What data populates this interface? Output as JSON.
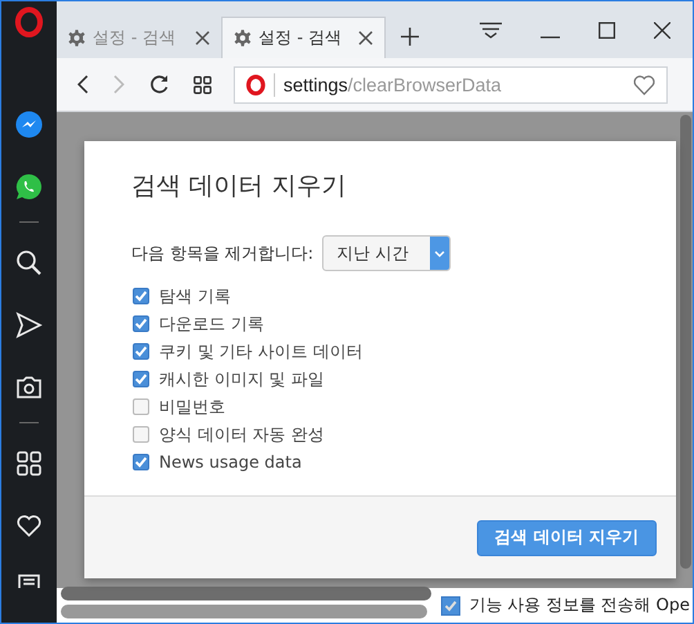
{
  "browser": {
    "tabs": [
      {
        "title": "설정 - 검색",
        "selected": false
      },
      {
        "title": "설정 - 검색",
        "selected": true
      }
    ],
    "address": {
      "host": "settings",
      "path": "/clearBrowserData"
    }
  },
  "sidebar": {
    "items": [
      {
        "kind": "messenger"
      },
      {
        "kind": "whatsapp"
      },
      {
        "kind": "divider"
      },
      {
        "kind": "search"
      },
      {
        "kind": "send"
      },
      {
        "kind": "camera"
      },
      {
        "kind": "divider"
      },
      {
        "kind": "grid"
      },
      {
        "kind": "heart"
      },
      {
        "kind": "news"
      }
    ]
  },
  "background_page": {
    "option": {
      "label": "기능 사용 정보를 전송해 Ope",
      "checked": true
    }
  },
  "dialog": {
    "title": "검색 데이터 지우기",
    "range_label": "다음 항목을 제거합니다:",
    "range_value": "지난 시간",
    "options": [
      {
        "label": "탐색 기록",
        "checked": true
      },
      {
        "label": "다운로드 기록",
        "checked": true
      },
      {
        "label": "쿠키 및 기타 사이트 데이터",
        "checked": true
      },
      {
        "label": "캐시한 이미지 및 파일",
        "checked": true
      },
      {
        "label": "비밀번호",
        "checked": false
      },
      {
        "label": "양식 데이터 자동 완성",
        "checked": false
      },
      {
        "label": "News usage data",
        "checked": true
      }
    ],
    "confirm_button": "검색 데이터 지우기"
  }
}
